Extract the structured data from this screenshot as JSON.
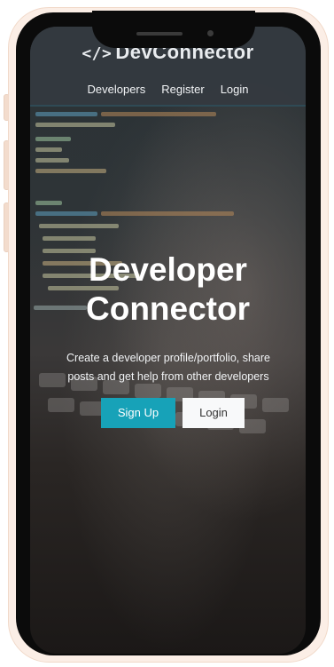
{
  "navbar": {
    "brand_icon": "</>",
    "brand_text": "DevConnector",
    "links": [
      "Developers",
      "Register",
      "Login"
    ]
  },
  "hero": {
    "title_line1": "Developer",
    "title_line2": "Connector",
    "subtitle_line1": "Create a developer profile/portfolio, share",
    "subtitle_line2": "posts and get help from other developers",
    "signup_label": "Sign Up",
    "login_label": "Login"
  },
  "colors": {
    "primary": "#17a2b8",
    "navbar": "#343a40",
    "light": "#f8f9fa",
    "bezel": "#fbeee6"
  },
  "icons": {
    "brand_icon": "code-icon"
  }
}
